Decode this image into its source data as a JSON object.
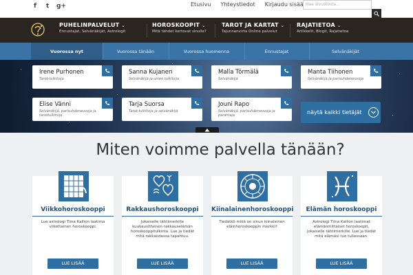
{
  "topbar": {
    "social": [
      {
        "icon": "facebook-icon",
        "glyph": "f"
      },
      {
        "icon": "twitter-icon",
        "glyph": "t"
      },
      {
        "icon": "googleplus-icon",
        "glyph": "g+"
      }
    ],
    "links": [
      "Etusivu",
      "Yhteystiedot",
      "Kirjaudu sisään"
    ],
    "search_placeholder": "Hae sivustosta..."
  },
  "nav": [
    {
      "title": "PUHELINPALVELUT",
      "sub": "Ennustajat, Selvänäkijät, Astrologit"
    },
    {
      "title": "HOROSKOOPIT",
      "sub": "Mitä tähdet kertovat sinulle?"
    },
    {
      "title": "TAROT JA KARTAT",
      "sub": "Tajunnanvirta Online palvelut"
    },
    {
      "title": "RAJATIETOA",
      "sub": "Artikkelit, Blogit, Rajatietoa"
    }
  ],
  "tabs": [
    "Vuorossa nyt",
    "Vuorossa tänään",
    "Vuorossa huomenna",
    "Ennustajat",
    "Selvänäkijät"
  ],
  "active_tab": "Vuorossa nyt",
  "advisors": [
    {
      "name": "Irene Purhonen",
      "role": "Tarot-tulkitsija"
    },
    {
      "name": "Sanna Kujanen",
      "role": "Selvänäkijä ja unien tulkitsija"
    },
    {
      "name": "Malla Törmälä",
      "role": "Selvänäkijä"
    },
    {
      "name": "Manta Tiihonen",
      "role": "Selvänäkijä ja parisuhdeneuvoja"
    },
    {
      "name": "Elise Vänni",
      "role": "Selvänäkijä, parisuhdeneuvoja ja tarottulkitsija"
    },
    {
      "name": "Tarja Suorsa",
      "role": "Tarot-tulkitsija ja selvänäkijä"
    },
    {
      "name": "Jouni Rapo",
      "role": "Selvänäkijä, parisuhdeneuvoja ja parantaja"
    }
  ],
  "all_button": "näytä kaikki tietäjät",
  "heading": "Miten voimme palvella tänään?",
  "services": [
    {
      "title": "Viikkohoroskooppi",
      "desc": "Lue astrologi Tiina Kallion laatima viikottainen horoskooppi.",
      "button": "LUE LISÄÄ",
      "icon": "calendar-icon"
    },
    {
      "title": "Rakkaushoroskooppi",
      "desc": "Jokaiselle tähtimerkille kuukausittainen rakkauselämän horoskooppitulkinta. Lue ja tiedät mitä rakkaudessa tapahtuu.",
      "button": "LUE LISÄÄ",
      "icon": "zodiac-love-icon"
    },
    {
      "title": "Kiinalainenhoroskooppi",
      "desc": "Tiedätkö mikä on sinun kiinalainen eläinhoroskooppin merkki?",
      "button": "LUE LISÄÄ",
      "icon": "chinese-zodiac-wheel-icon"
    },
    {
      "title": "Elämän horoskooppi",
      "desc": "Astrologi Tiina Kallion laatimat elämänmittaiset horoskoopit, jokaiselle tähtimerkille. Lue ja tiedät mitä elämäsi tuo tullessaan.",
      "button": "LUE LISÄÄ",
      "icon": "pisces-icon"
    }
  ],
  "colors": {
    "accent": "#2f6ea1",
    "nav_dark": "#2b2522",
    "subnav": "#3a73a6"
  }
}
